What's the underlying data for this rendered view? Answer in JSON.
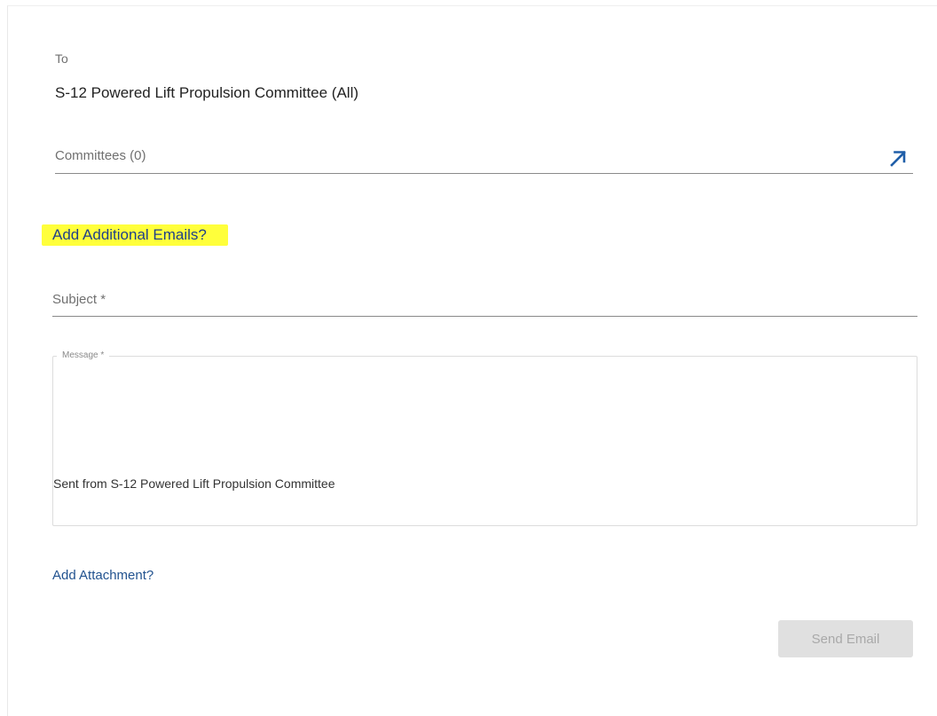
{
  "to": {
    "label": "To",
    "value": "S-12 Powered Lift Propulsion Committee (All)"
  },
  "committees": {
    "label": "Committees (0)",
    "icon": "expand-arrow-icon"
  },
  "add_emails": {
    "label": "Add Additional Emails?",
    "highlight_color": "#ffff3b",
    "text_color": "#1f3f88"
  },
  "subject": {
    "placeholder": "Subject *",
    "value": ""
  },
  "message": {
    "legend": "Message *",
    "body": "Sent from S-12 Powered Lift Propulsion Committee"
  },
  "attachment": {
    "label": "Add Attachment?"
  },
  "send": {
    "label": "Send Email",
    "disabled": true
  },
  "colors": {
    "link": "#21528f",
    "button_disabled_bg": "#e0e0e0",
    "button_disabled_text": "#a9a9a9"
  }
}
